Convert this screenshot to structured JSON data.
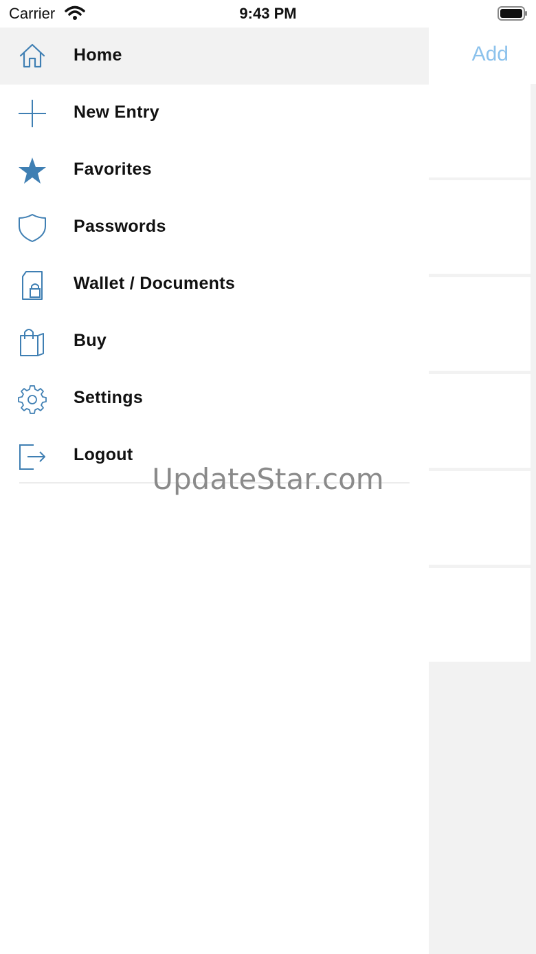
{
  "status_bar": {
    "carrier": "Carrier",
    "time": "9:43 PM"
  },
  "main": {
    "add_label": "Add"
  },
  "drawer": {
    "items": [
      {
        "label": "Home",
        "icon": "home-icon",
        "active": true
      },
      {
        "label": "New Entry",
        "icon": "plus-icon"
      },
      {
        "label": "Favorites",
        "icon": "star-icon"
      },
      {
        "label": "Passwords",
        "icon": "shield-icon"
      },
      {
        "label": "Wallet / Documents",
        "icon": "wallet-lock-icon"
      },
      {
        "label": "Buy",
        "icon": "shopping-bag-icon"
      },
      {
        "label": "Settings",
        "icon": "gear-icon"
      },
      {
        "label": "Logout",
        "icon": "logout-icon"
      }
    ]
  },
  "watermark": "UpdateStar.com",
  "colors": {
    "accent_icon": "#3f7fb3",
    "add_button": "#8cc2ec",
    "active_row": "#f2f2f2",
    "background_gray": "#f2f2f2"
  }
}
